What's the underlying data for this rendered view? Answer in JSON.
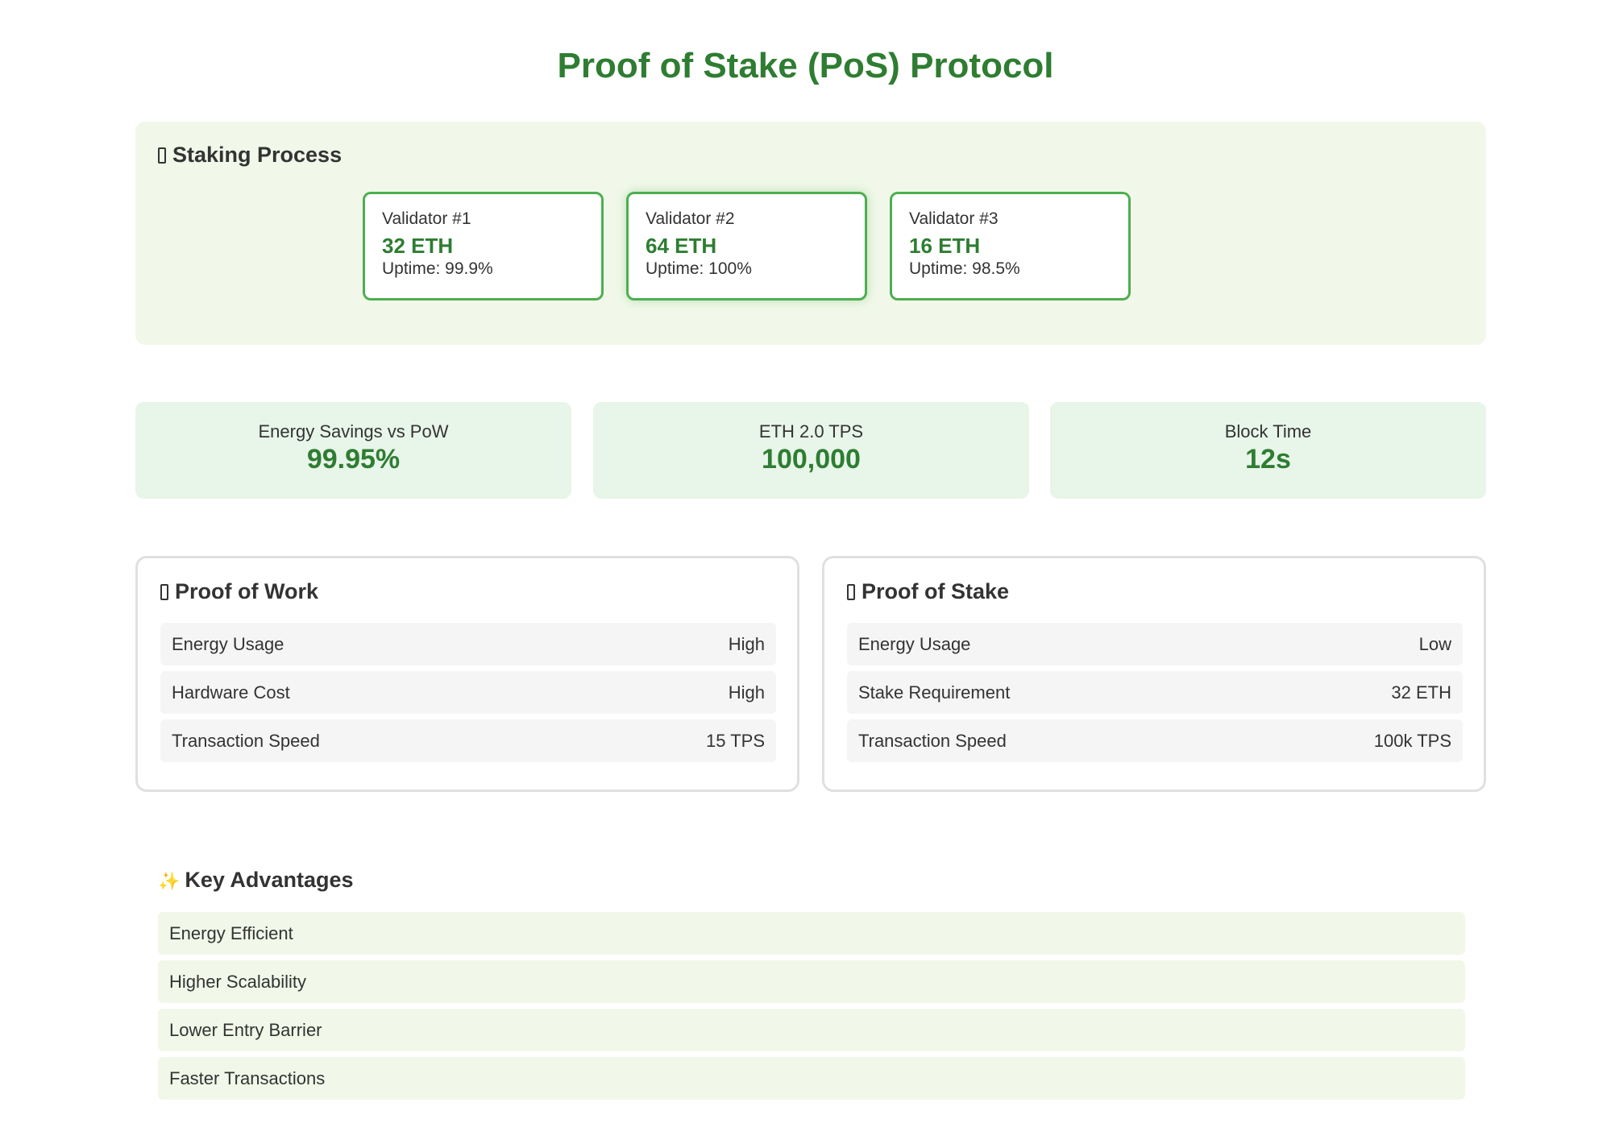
{
  "page": {
    "title": "Proof of Stake (PoS) Protocol"
  },
  "staking": {
    "heading": "Staking Process",
    "validators": [
      {
        "name": "Validator #1",
        "stake": "32 ETH",
        "uptime": "Uptime: 99.9%"
      },
      {
        "name": "Validator #2",
        "stake": "64 ETH",
        "uptime": "Uptime: 100%"
      },
      {
        "name": "Validator #3",
        "stake": "16 ETH",
        "uptime": "Uptime: 98.5%"
      }
    ]
  },
  "stats": [
    {
      "label": "Energy Savings vs PoW",
      "value": "99.95%"
    },
    {
      "label": "ETH 2.0 TPS",
      "value": "100,000"
    },
    {
      "label": "Block Time",
      "value": "12s"
    }
  ],
  "comparison": {
    "pow": {
      "heading": "Proof of Work",
      "rows": [
        {
          "label": "Energy Usage",
          "value": "High"
        },
        {
          "label": "Hardware Cost",
          "value": "High"
        },
        {
          "label": "Transaction Speed",
          "value": "15 TPS"
        }
      ]
    },
    "pos": {
      "heading": "Proof of Stake",
      "rows": [
        {
          "label": "Energy Usage",
          "value": "Low"
        },
        {
          "label": "Stake Requirement",
          "value": "32 ETH"
        },
        {
          "label": "Transaction Speed",
          "value": "100k TPS"
        }
      ]
    }
  },
  "advantages": {
    "icon": "sparkles-icon",
    "heading": "Key Advantages",
    "items": [
      "Energy Efficient",
      "Higher Scalability",
      "Lower Entry Barrier",
      "Faster Transactions"
    ]
  },
  "colors": {
    "accent": "#2e7d32",
    "validator_border": "#4caf50",
    "staking_bg": "#f1f8e9",
    "stat_bg": "#e8f5e9"
  }
}
